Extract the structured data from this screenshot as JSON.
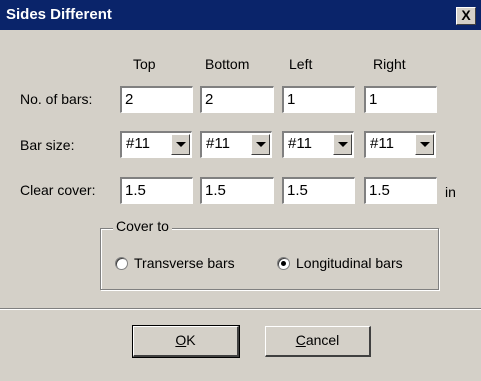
{
  "window": {
    "title": "Sides Different",
    "close_glyph": "X"
  },
  "columns": [
    "Top",
    "Bottom",
    "Left",
    "Right"
  ],
  "rows": {
    "bars": {
      "label": "No. of bars:",
      "values": [
        "2",
        "2",
        "1",
        "1"
      ]
    },
    "size": {
      "label": "Bar size:",
      "values": [
        "#11",
        "#11",
        "#11",
        "#11"
      ]
    },
    "cover": {
      "label": "Clear cover:",
      "values": [
        "1.5",
        "1.5",
        "1.5",
        "1.5"
      ],
      "unit": "in"
    }
  },
  "cover_to": {
    "label": "Cover to",
    "options": [
      {
        "label": "Transverse bars",
        "selected": false
      },
      {
        "label": "Longitudinal bars",
        "selected": true
      }
    ]
  },
  "buttons": {
    "ok": {
      "mnemonic": "O",
      "rest": "K"
    },
    "cancel": {
      "mnemonic": "C",
      "rest": "ancel"
    }
  }
}
